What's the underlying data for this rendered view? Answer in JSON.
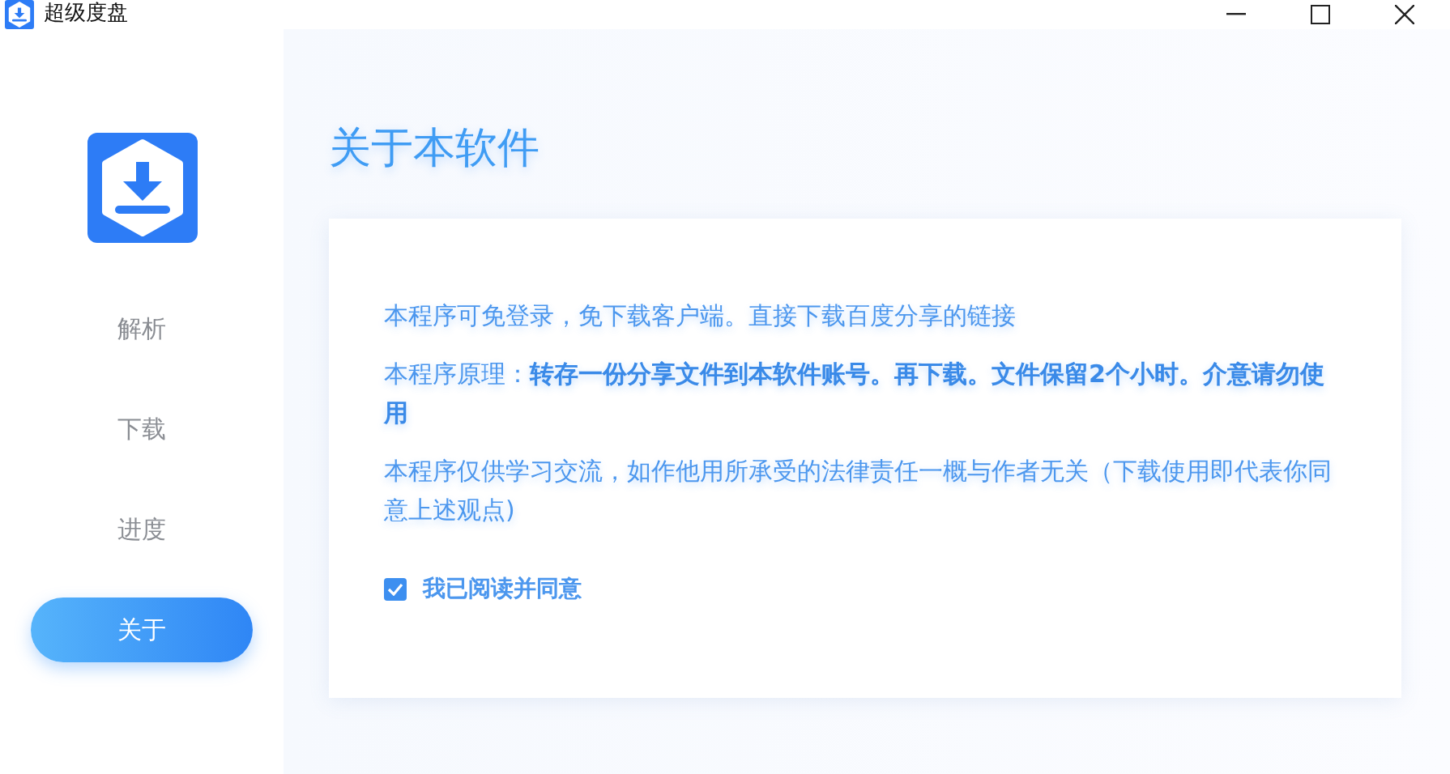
{
  "window": {
    "title": "超级度盘"
  },
  "sidebar": {
    "items": [
      {
        "label": "解析",
        "selected": false
      },
      {
        "label": "下载",
        "selected": false
      },
      {
        "label": "进度",
        "selected": false
      },
      {
        "label": "关于",
        "selected": true
      }
    ]
  },
  "page": {
    "heading": "关于本软件",
    "paragraphs": [
      "本程序可免登录，免下载客户端。直接下载百度分享的链接",
      "本程序原理：**转存一份分享文件到本软件账号。再下载。文件保留2个小时。介意请勿使用**",
      "本程序仅供学习交流，如作他用所承受的法律责任一概与作者无关（下载使用即代表你同意上述观点)"
    ],
    "agreement": {
      "label": "我已阅读并同意",
      "checked": true
    }
  }
}
